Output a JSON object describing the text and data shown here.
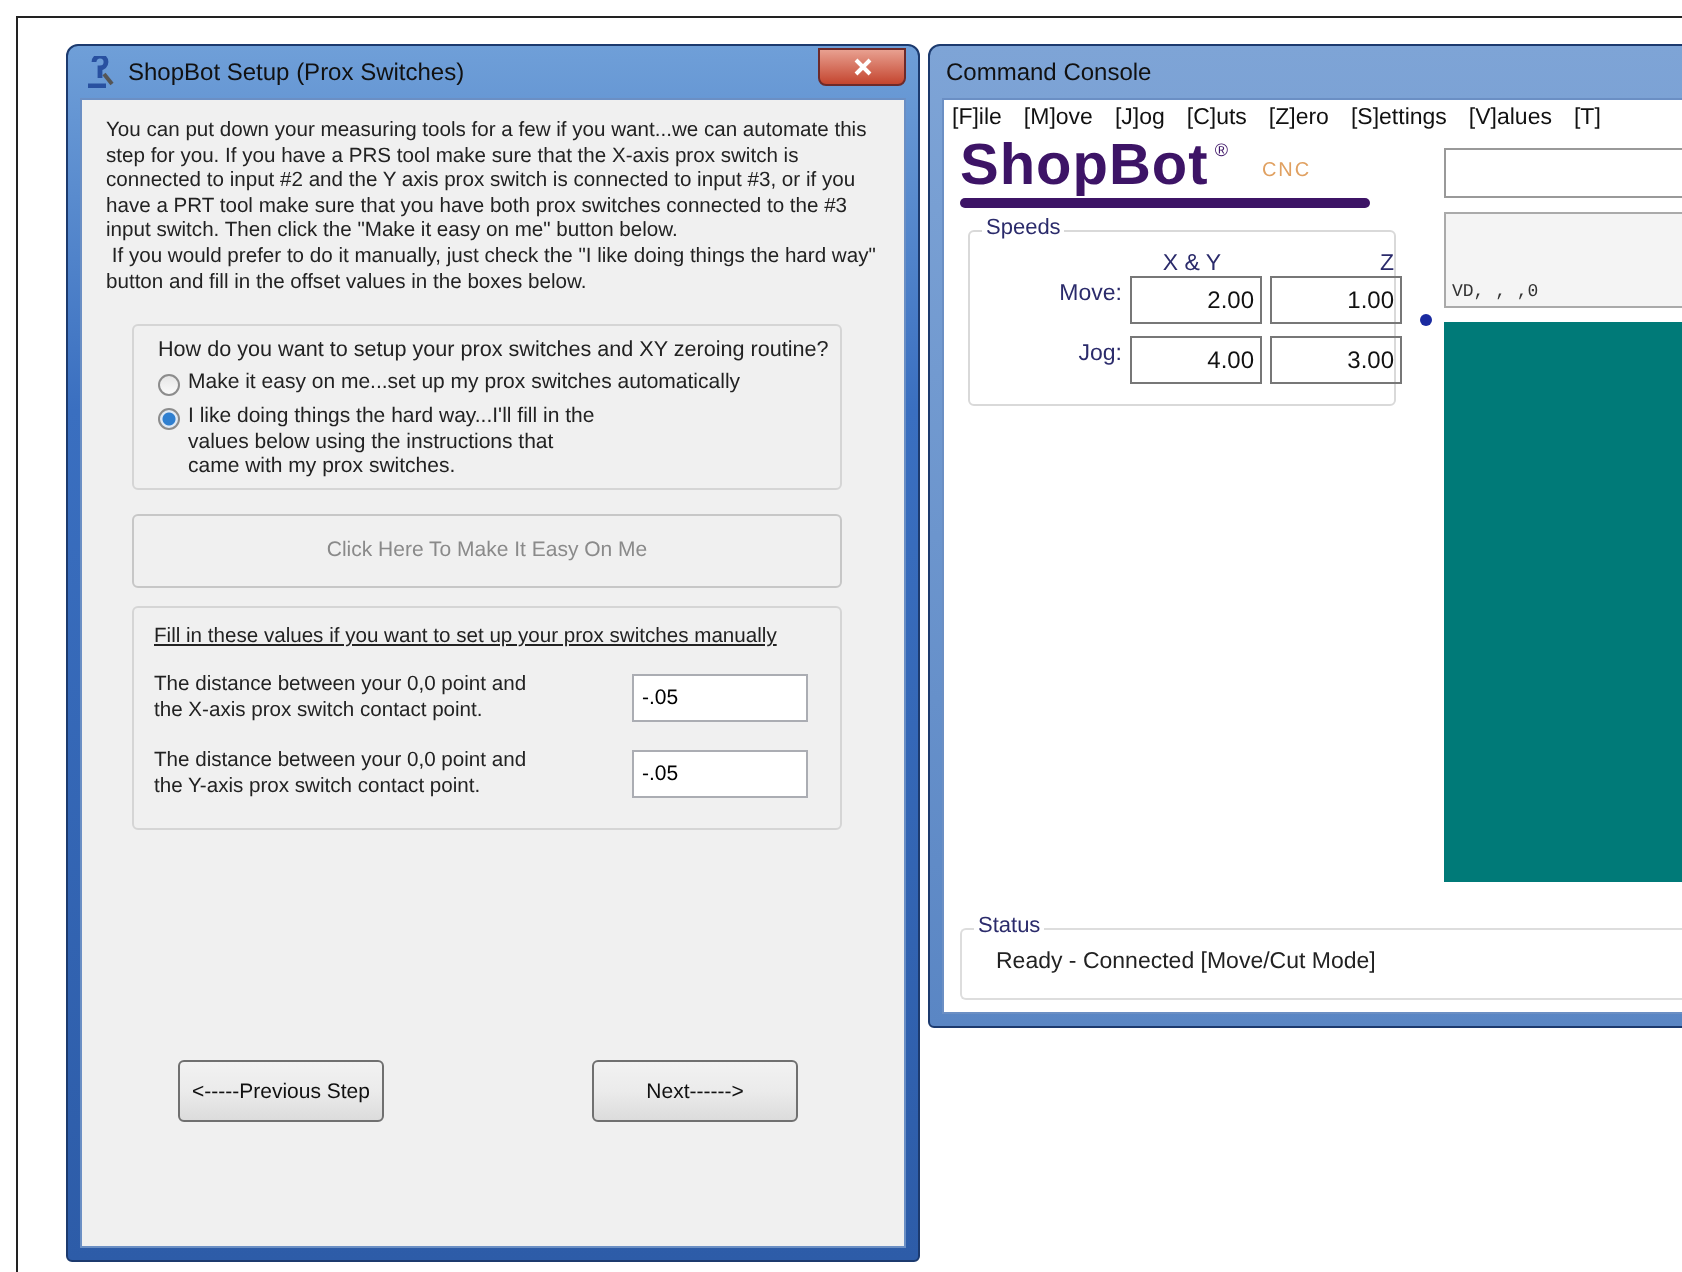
{
  "setup_dialog": {
    "title": "ShopBot Setup (Prox Switches)",
    "intro": [
      "You can put down your measuring tools for a few if you want...we can automate this step for you. If you have a PRS tool make sure that the X-axis prox switch is connected to input #2 and the Y axis prox switch is connected to input #3, or if you have a PRT tool make sure that you have both prox switches connected to the #3 input switch. Then click the \"Make it easy on me\" button below.",
      " If you would prefer to do it manually, just check the \"I like doing things the hard way\" button and fill in the offset values in the boxes below."
    ],
    "routine_group": {
      "question": "How do you want to setup your prox switches and  XY zeroing routine?",
      "options": [
        {
          "label": "Make it easy on me...set up my prox switches automatically",
          "selected": false
        },
        {
          "label": "I like doing things the hard way...I'll fill in the values below using the instructions that came with my prox switches.",
          "selected": true
        }
      ]
    },
    "easy_button": {
      "label": "Click Here To Make It Easy On Me",
      "disabled": true
    },
    "manual_group": {
      "heading": "Fill in these values if you want to set up your prox switches manually",
      "fields": [
        {
          "label": "The distance between your 0,0 point and the X-axis prox switch contact point.",
          "value": "-.05"
        },
        {
          "label": "The distance between your 0,0 point and the Y-axis prox switch contact point.",
          "value": "-.05"
        }
      ]
    },
    "buttons": [
      "<-----Previous Step",
      "Next------>"
    ]
  },
  "console": {
    "title": "Command Console",
    "menu": [
      "[F]ile",
      "[M]ove",
      "[J]og",
      "[C]uts",
      "[Z]ero",
      "[S]ettings",
      "[V]alues",
      "[T]"
    ],
    "logo": {
      "name": "ShopBot",
      "registered": "®",
      "suffix": "CNC"
    },
    "speeds": {
      "title": "Speeds",
      "columns": [
        "X & Y",
        "Z"
      ],
      "rows": [
        {
          "label": "Move:",
          "values": [
            "2.00",
            "1.00"
          ]
        },
        {
          "label": "Jog:",
          "values": [
            "4.00",
            "3.00"
          ]
        }
      ]
    },
    "command_line": "VD, , ,0",
    "status": {
      "title": "Status",
      "text": "Ready - Connected  [Move/Cut Mode]"
    }
  }
}
